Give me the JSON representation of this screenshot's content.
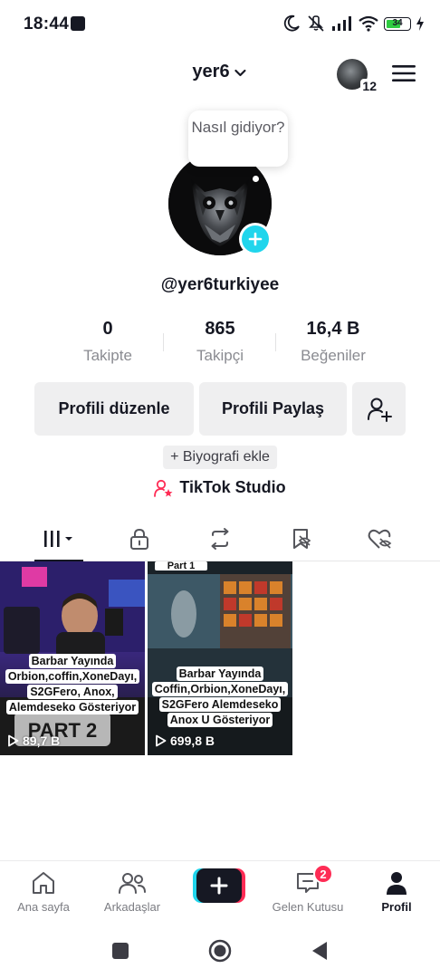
{
  "status_bar": {
    "time": "18:44",
    "battery": "34"
  },
  "header": {
    "username": "yer6",
    "account_count": "12"
  },
  "profile": {
    "bubble_text": "Nasıl gidiyor?",
    "handle": "@yer6turkiyee",
    "stats": [
      {
        "value": "0",
        "label": "Takipte"
      },
      {
        "value": "865",
        "label": "Takipçi"
      },
      {
        "value": "16,4 B",
        "label": "Beğeniler"
      }
    ],
    "edit_profile": "Profili düzenle",
    "share_profile": "Profili Paylaş",
    "add_bio": "+ Biyografi ekle",
    "studio": "TikTok Studio"
  },
  "tabs": [
    "videos",
    "private",
    "reposts",
    "favorites",
    "liked"
  ],
  "videos": [
    {
      "caption": [
        "Barbar Yayında",
        "Orbion,coffin,XoneDayı,",
        "S2GFero, Anox,",
        "Alemdeseko Gösteriyor"
      ],
      "overlay": "PART 2",
      "views": "89,7 B"
    },
    {
      "caption": [
        "Barbar Yayında",
        "Coffin,Orbion,XoneDayı,",
        "S2GFero Alemdeseko",
        "Anox U Gösteriyor"
      ],
      "overlay": "Part 1",
      "views": "699,8 B"
    }
  ],
  "bottom_nav": {
    "home": "Ana sayfa",
    "friends": "Arkadaşlar",
    "inbox": "Gelen Kutusu",
    "inbox_badge": "2",
    "profile": "Profil"
  },
  "colors": {
    "accent_cyan": "#20d5ec",
    "accent_red": "#fe2c55",
    "text": "#161823",
    "muted": "#8a8b91"
  }
}
